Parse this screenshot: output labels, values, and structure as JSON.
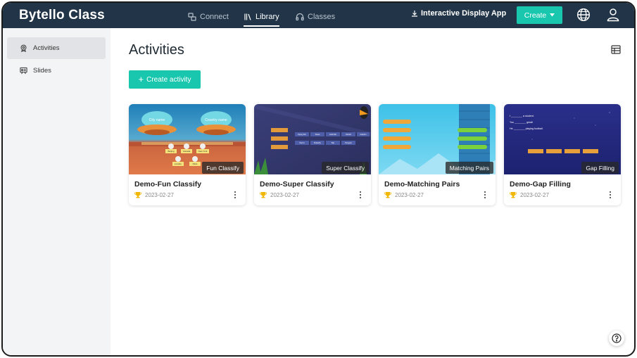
{
  "app": {
    "name": "Bytello Class"
  },
  "nav": {
    "connect": "Connect",
    "library": "Library",
    "classes": "Classes"
  },
  "header": {
    "interactive_display_app": "Interactive Display App",
    "create_label": "Create"
  },
  "sidebar": {
    "items": [
      {
        "label": "Activities",
        "icon": "trophy-icon",
        "active": true
      },
      {
        "label": "Slides",
        "icon": "slides-icon",
        "active": false
      }
    ]
  },
  "main": {
    "title": "Activities",
    "create_activity_label": "Create activity"
  },
  "cards": [
    {
      "name": "Demo-Fun Classify",
      "date": "2023-02-27",
      "type": "Fun Classify",
      "thumb_labels": [
        "City name",
        "Country name",
        "Beijing",
        "Canada",
        "New York",
        "London",
        "Paris"
      ]
    },
    {
      "name": "Demo-Super Classify",
      "date": "2023-02-27",
      "type": "Super Classify",
      "thumb_labels": [
        "Flying fish",
        "Shark",
        "Gold fish",
        "Ostrich",
        "Dolphin",
        "Parrot",
        "Butterfly",
        "Bat",
        "Penguin"
      ]
    },
    {
      "name": "Demo-Matching Pairs",
      "date": "2023-02-27",
      "type": "Matching Pairs",
      "thumb_labels": []
    },
    {
      "name": "Demo-Gap Filling",
      "date": "2023-02-27",
      "type": "Gap Filling",
      "thumb_labels": [
        "I ________ a student.",
        "You ________ great!",
        "He ________ playing football."
      ]
    }
  ],
  "colors": {
    "topbar": "#223548",
    "accent": "#19c7ae",
    "sidebar": "#f3f4f6",
    "trophy": "#f2b705"
  }
}
